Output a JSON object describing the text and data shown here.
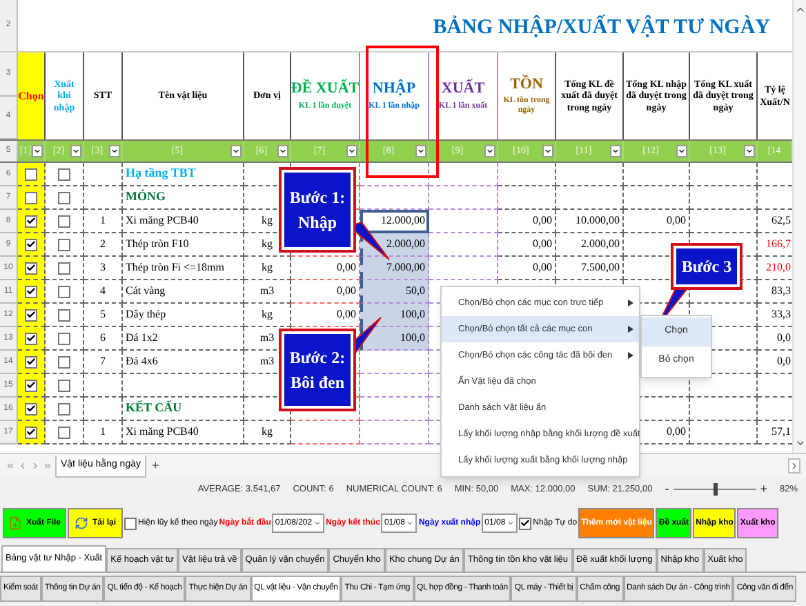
{
  "sheet": {
    "title": "BẢNG NHẬP/XUẤT VẬT TƯ NGÀY",
    "title_row": "2",
    "header_rows": [
      "3",
      "4"
    ],
    "filter_row": "5",
    "columns": [
      {
        "kind": "select",
        "title": "Chọn",
        "color": "#ff0000",
        "filter": "[1]"
      },
      {
        "kind": "plain",
        "title": "Xuất khi nhập",
        "color": "#00b0f0",
        "filter": "[2]"
      },
      {
        "kind": "plain",
        "title": "STT",
        "color": "#000000",
        "filter": "[3]"
      },
      {
        "kind": "plain",
        "title": "Tên vật liệu",
        "color": "#000000",
        "filter": "[5]"
      },
      {
        "kind": "plain",
        "title": "Đơn vị",
        "color": "#000000",
        "filter": "[6]"
      },
      {
        "kind": "big",
        "title": "ĐỀ XUẤT",
        "subtitle": "KL 1 lần duyệt",
        "color": "#00b050",
        "filter": "[7]"
      },
      {
        "kind": "big",
        "title": "NHẬP",
        "subtitle": "KL 1 lần nhập",
        "color": "#0070c0",
        "filter": "[8]"
      },
      {
        "kind": "big",
        "title": "XUẤT",
        "subtitle": "KL 1 lần xuất",
        "color": "#7030a0",
        "filter": "[9]"
      },
      {
        "kind": "big",
        "title": "TỒN",
        "subtitle": "KL tồn trong ngày",
        "color": "#9c6500",
        "filter": "[10]"
      },
      {
        "kind": "plain",
        "title": "Tổng KL đề xuất đã duyệt trong ngày",
        "color": "#000000",
        "filter": "[11]"
      },
      {
        "kind": "plain",
        "title": "Tổng KL nhập đã duyệt trong ngày",
        "color": "#000000",
        "filter": "[12]"
      },
      {
        "kind": "plain",
        "title": "Tổng KL xuất đã duyệt trong ngày",
        "color": "#000000",
        "filter": "[13]"
      },
      {
        "kind": "plain",
        "title": "Tỷ lệ Xuất/N",
        "color": "#000000",
        "filter": "[14"
      }
    ],
    "rows": [
      {
        "num": "6",
        "kind": "group",
        "nhap_selected": false,
        "nhap_active": false,
        "cells": [
          false,
          false,
          "",
          "Hạ tầng TBT",
          "",
          "",
          "",
          "",
          "",
          "",
          "",
          "",
          ""
        ]
      },
      {
        "num": "7",
        "kind": "section",
        "nhap_selected": false,
        "nhap_active": false,
        "cells": [
          false,
          false,
          "",
          "MÓNG",
          "",
          "",
          "",
          "",
          "",
          "",
          "",
          "",
          ""
        ]
      },
      {
        "num": "8",
        "kind": "item",
        "nhap_selected": true,
        "nhap_active": true,
        "ratio_alert": false,
        "cells": [
          true,
          false,
          "1",
          "Xi măng PCB40",
          "kg",
          "",
          "12.000,00",
          "",
          "0,00",
          "10.000,00",
          "0,00",
          "",
          "62,5"
        ]
      },
      {
        "num": "9",
        "kind": "item",
        "nhap_selected": true,
        "nhap_active": false,
        "ratio_alert": true,
        "cells": [
          true,
          false,
          "2",
          "Thép tròn F10",
          "kg",
          "",
          "2.000,00",
          "",
          "0,00",
          "2.000,00",
          "",
          "",
          "166,7"
        ]
      },
      {
        "num": "10",
        "kind": "item",
        "nhap_selected": true,
        "nhap_active": false,
        "ratio_alert": true,
        "cells": [
          true,
          false,
          "3",
          "Thép tròn Fi <=18mm",
          "kg",
          "0,00",
          "7.000,00",
          "",
          "0,00",
          "7.500,00",
          "",
          "",
          "210,0"
        ]
      },
      {
        "num": "11",
        "kind": "item",
        "nhap_selected": true,
        "nhap_active": false,
        "ratio_alert": false,
        "cells": [
          true,
          false,
          "4",
          "Cát vàng",
          "m3",
          "0,00",
          "50,0",
          "",
          "",
          "",
          "",
          "",
          "83,3"
        ]
      },
      {
        "num": "12",
        "kind": "item",
        "nhap_selected": true,
        "nhap_active": false,
        "ratio_alert": false,
        "cells": [
          true,
          false,
          "5",
          "Dây thép",
          "kg",
          "0,00",
          "100,0",
          "",
          "",
          "",
          "",
          "",
          "33,3"
        ]
      },
      {
        "num": "13",
        "kind": "item",
        "nhap_selected": true,
        "nhap_active": false,
        "ratio_alert": false,
        "cells": [
          true,
          false,
          "6",
          "Đá 1x2",
          "m3",
          "",
          "100,0",
          "",
          "",
          "",
          "",
          "",
          "0,0"
        ]
      },
      {
        "num": "14",
        "kind": "item",
        "nhap_selected": false,
        "nhap_active": false,
        "ratio_alert": false,
        "cells": [
          true,
          false,
          "7",
          "Đá 4x6",
          "m3",
          "",
          "",
          "",
          "",
          "",
          "",
          "",
          "0,0"
        ]
      },
      {
        "num": "15",
        "kind": "blank",
        "nhap_selected": false,
        "nhap_active": false,
        "cells": [
          true,
          false,
          "",
          "",
          "",
          "",
          "",
          "",
          "",
          "",
          "",
          "",
          ""
        ]
      },
      {
        "num": "16",
        "kind": "section",
        "nhap_selected": false,
        "nhap_active": false,
        "cells": [
          true,
          false,
          "",
          "KẾT CẤU",
          "",
          "",
          "",
          "",
          "",
          "",
          "",
          "",
          ""
        ]
      },
      {
        "num": "17",
        "kind": "item",
        "nhap_selected": false,
        "nhap_active": false,
        "ratio_alert": false,
        "cells": [
          true,
          false,
          "1",
          "Xi măng PCB40",
          "kg",
          "",
          "",
          "",
          "",
          "",
          "0,00",
          "",
          "57,1"
        ]
      }
    ]
  },
  "callouts": [
    "Bước 1: Nhập",
    "Bước 2: Bôi đen",
    "Bước 3"
  ],
  "context_menu": [
    {
      "label": "Chọn/Bỏ chọn các mục con trực tiếp",
      "submenu": true,
      "selected": false
    },
    {
      "label": "Chọn/Bỏ chọn tất cả các mục con",
      "submenu": true,
      "selected": true
    },
    {
      "label": "Chọn/Bỏ chọn các công tác đã bôi đen",
      "submenu": true,
      "selected": false
    },
    {
      "label": "Ẩn Vật liệu đã chọn",
      "submenu": false,
      "selected": false
    },
    {
      "label": "Danh sách Vật liệu ẩn",
      "submenu": false,
      "selected": false
    },
    {
      "label": "Lấy khối lượng nhập bằng khối lượng đề xuất",
      "submenu": false,
      "selected": false
    },
    {
      "label": "Lấy khối lượng xuất bằng khối lượng nhập",
      "submenu": false,
      "selected": false
    }
  ],
  "submenu": [
    {
      "label": "Chọn",
      "selected": true
    },
    {
      "label": "Bỏ chọn",
      "selected": false
    }
  ],
  "sheet_tabs": [
    {
      "label": "Vật liệu hằng ngày",
      "selected": true
    }
  ],
  "add_sheet": "+",
  "status_bar": {
    "items": [
      "AVERAGE: 3.541,67",
      "COUNT: 6",
      "NUMERICAL COUNT: 6",
      "MIN: 50,00",
      "MAX: 12.000,00",
      "SUM: 21.250,00"
    ],
    "zoom_out": "-",
    "zoom_in": "+",
    "zoom": {
      "level": 0.5
    },
    "zoom_percent": "82%"
  },
  "toolbar": [
    {
      "kind": "button",
      "label": "Xuất File",
      "color": "#00ff00"
    },
    {
      "kind": "button",
      "label": "Tải lại",
      "color": "#ffff00"
    },
    {
      "kind": "checkbox",
      "label": "Hiện lũy kế theo ngày",
      "checked": false
    },
    {
      "kind": "label",
      "label": "Ngày bắt đầu",
      "color": "#ff0000"
    },
    {
      "kind": "date",
      "value": "01/08/202"
    },
    {
      "kind": "label",
      "label": "Ngày kết thúc",
      "color": "#ff0000"
    },
    {
      "kind": "date",
      "value": "01/08"
    },
    {
      "kind": "label",
      "label": "Ngày xuất nhập",
      "color": "#0000ff"
    },
    {
      "kind": "date",
      "value": "01/08"
    },
    {
      "kind": "checkbox",
      "label": "Nhập Tự do",
      "checked": true
    },
    {
      "kind": "primary_button",
      "label": "Thêm mới vật liệu",
      "color": "#ff8000"
    },
    {
      "kind": "button",
      "label": "Đề xuất",
      "color": "#00ff00"
    },
    {
      "kind": "button",
      "label": "Nhập kho",
      "color": "#ffff00"
    },
    {
      "kind": "button",
      "label": "Xuất kho",
      "color": "#ff99ff"
    }
  ],
  "tabs_inner": [
    {
      "label": "Bảng vật tư Nhập - Xuất",
      "selected": true
    },
    {
      "label": "Kế hoạch vật tư",
      "selected": false
    },
    {
      "label": "Vật liệu trả về",
      "selected": false
    },
    {
      "label": "Quản lý vận chuyển",
      "selected": false
    },
    {
      "label": "Chuyển kho",
      "selected": false
    },
    {
      "label": "Kho chung Dự án",
      "selected": false
    },
    {
      "label": "Thông tin tồn kho vật liệu",
      "selected": false
    },
    {
      "label": "Đề xuất khối lượng",
      "selected": false
    },
    {
      "label": "Nhập kho",
      "selected": false
    },
    {
      "label": "Xuất kho",
      "selected": false
    }
  ],
  "tabs_main": [
    {
      "label": "Kiểm soát",
      "selected": false
    },
    {
      "label": "Thông tin Dự án",
      "selected": false
    },
    {
      "label": "QL tiến độ - Kế hoạch",
      "selected": false
    },
    {
      "label": "Thực hiện Dự án",
      "selected": false
    },
    {
      "label": "QL vật liệu - Vận chuyển",
      "selected": true
    },
    {
      "label": "Thu Chi - Tạm ứng",
      "selected": false
    },
    {
      "label": "QL hợp đồng - Thanh toán",
      "selected": false
    },
    {
      "label": "QL máy - Thiết bị",
      "selected": false
    },
    {
      "label": "Chấm công",
      "selected": false
    },
    {
      "label": "Danh sách Dự án - Công trình",
      "selected": false
    },
    {
      "label": "Công văn đi đến",
      "selected": false
    }
  ]
}
